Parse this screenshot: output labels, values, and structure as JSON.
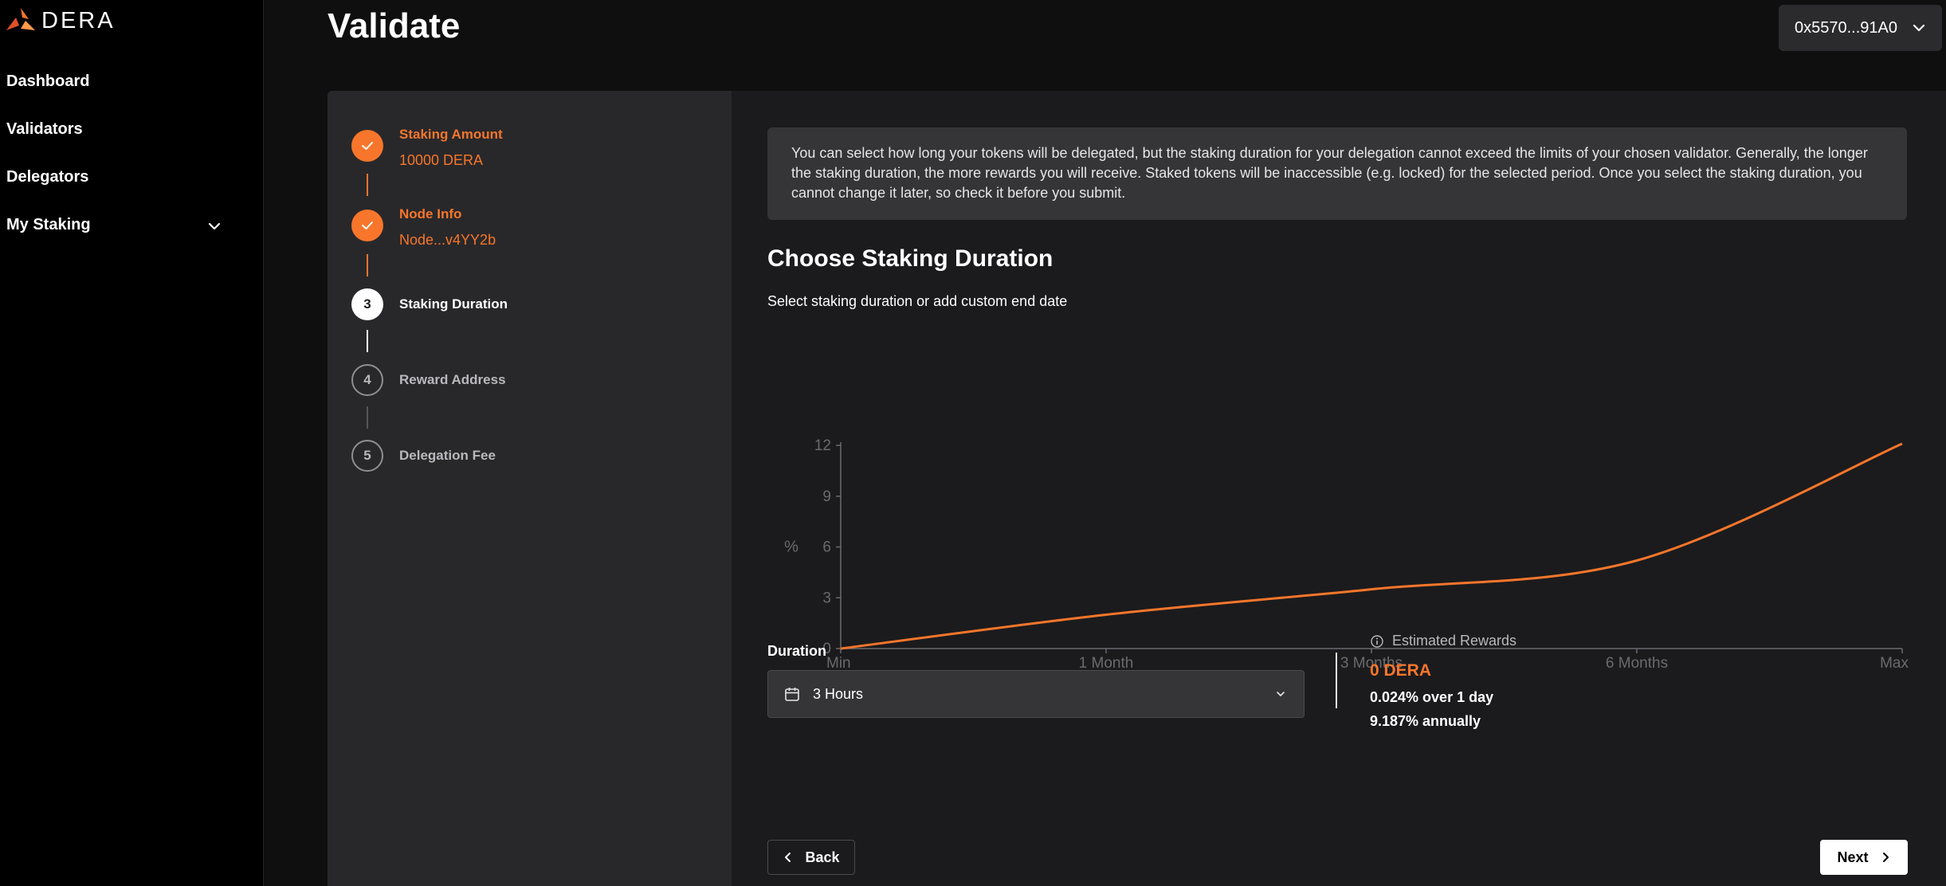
{
  "app": {
    "logo_text": "DERA",
    "accent": "#f7762b"
  },
  "sidebar": {
    "items": [
      {
        "label": "Dashboard"
      },
      {
        "label": "Validators"
      },
      {
        "label": "Delegators"
      },
      {
        "label": "My Staking"
      }
    ]
  },
  "header": {
    "title": "Validate",
    "wallet": "0x5570...91A0"
  },
  "steps": [
    {
      "number": "1",
      "title": "Staking Amount",
      "value": "10000 DERA",
      "status": "done"
    },
    {
      "number": "2",
      "title": "Node Info",
      "value": "Node...v4YY2b",
      "status": "done"
    },
    {
      "number": "3",
      "title": "Staking Duration",
      "value": "",
      "status": "active"
    },
    {
      "number": "4",
      "title": "Reward Address",
      "value": "",
      "status": "pending"
    },
    {
      "number": "5",
      "title": "Delegation Fee",
      "value": "",
      "status": "pending"
    }
  ],
  "info": {
    "text": "You can select how long your tokens will be delegated, but the staking duration for your delegation cannot exceed the limits of your chosen validator. Generally, the longer the staking duration, the more rewards you will receive. Staked tokens will be inaccessible (e.g. locked) for the selected period. Once you select the staking duration, you cannot change it later, so check it before you submit."
  },
  "section": {
    "title": "Choose Staking Duration",
    "subtitle": "Select staking duration or add custom end date"
  },
  "chart_data": {
    "type": "line",
    "categories": [
      "Min",
      "1 Month",
      "3 Months",
      "6 Months",
      "Max"
    ],
    "ylabel": "%",
    "yticks": [
      "0",
      "3",
      "6",
      "9",
      "12"
    ],
    "ylim": [
      0,
      12
    ],
    "series": [
      {
        "values": [
          0,
          2.0,
          3.5,
          5.2,
          12.1
        ]
      }
    ],
    "grid": false,
    "line_color": "#f7762b"
  },
  "duration": {
    "label": "Duration",
    "value": "3 Hours"
  },
  "rewards": {
    "label": "Estimated Rewards",
    "amount": "0 DERA",
    "per_day": "0.024% over 1 day",
    "annual": "9.187% annually"
  },
  "nav_buttons": {
    "back": "Back",
    "next": "Next"
  }
}
